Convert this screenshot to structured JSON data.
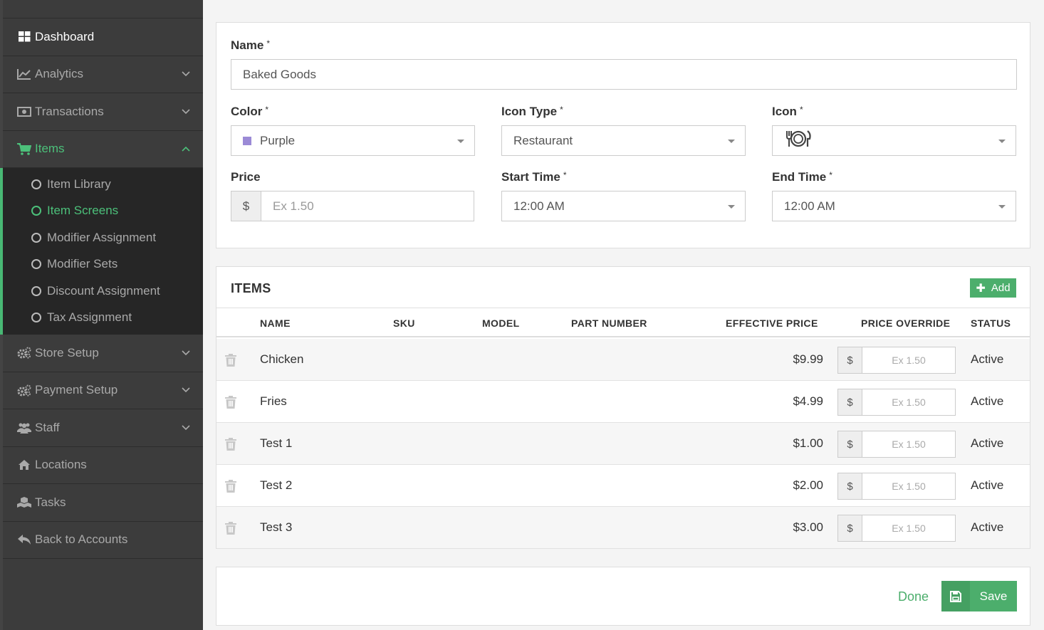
{
  "colors": {
    "sidebar_bg": "#3c3c3c",
    "accent": "#4cae6c",
    "active_green": "#4cc07a",
    "purple_swatch": "#9b8ad6"
  },
  "sidebar": {
    "items": [
      {
        "label": "Dashboard",
        "icon": "grid-icon"
      },
      {
        "label": "Analytics",
        "icon": "line-chart-icon"
      },
      {
        "label": "Transactions",
        "icon": "money-icon"
      },
      {
        "label": "Items",
        "icon": "cart-icon"
      },
      {
        "label": "Store Setup",
        "icon": "gears-icon"
      },
      {
        "label": "Payment Setup",
        "icon": "gears-icon"
      },
      {
        "label": "Staff",
        "icon": "users-icon"
      },
      {
        "label": "Locations",
        "icon": "home-icon"
      },
      {
        "label": "Tasks",
        "icon": "cubes-icon"
      },
      {
        "label": "Back to Accounts",
        "icon": "reply-icon"
      }
    ],
    "submenu": [
      "Item Library",
      "Item Screens",
      "Modifier Assignment",
      "Modifier Sets",
      "Discount Assignment",
      "Tax Assignment"
    ]
  },
  "form": {
    "name_label": "Name",
    "name_value": "Baked Goods",
    "required_mark": "*",
    "color_label": "Color",
    "color_value": "Purple",
    "icon_type_label": "Icon Type",
    "icon_type_value": "Restaurant",
    "icon_label": "Icon",
    "icon_value": "utensils-plate-icon",
    "price_label": "Price",
    "currency": "$",
    "price_placeholder": "Ex 1.50",
    "start_time_label": "Start Time",
    "start_time_value": "12:00 AM",
    "end_time_label": "End Time",
    "end_time_value": "12:00 AM"
  },
  "items_panel": {
    "title": "ITEMS",
    "add_label": "Add",
    "headers": {
      "name": "NAME",
      "sku": "SKU",
      "model": "MODEL",
      "part_number": "PART NUMBER",
      "effective_price": "EFFECTIVE PRICE",
      "price_override": "PRICE OVERRIDE",
      "status": "STATUS"
    },
    "override_placeholder": "Ex 1.50",
    "rows": [
      {
        "name": "Chicken",
        "price": "$9.99",
        "status": "Active"
      },
      {
        "name": "Fries",
        "price": "$4.99",
        "status": "Active"
      },
      {
        "name": "Test 1",
        "price": "$1.00",
        "status": "Active"
      },
      {
        "name": "Test 2",
        "price": "$2.00",
        "status": "Active"
      },
      {
        "name": "Test 3",
        "price": "$3.00",
        "status": "Active"
      }
    ]
  },
  "footer": {
    "done_label": "Done",
    "save_label": "Save"
  }
}
